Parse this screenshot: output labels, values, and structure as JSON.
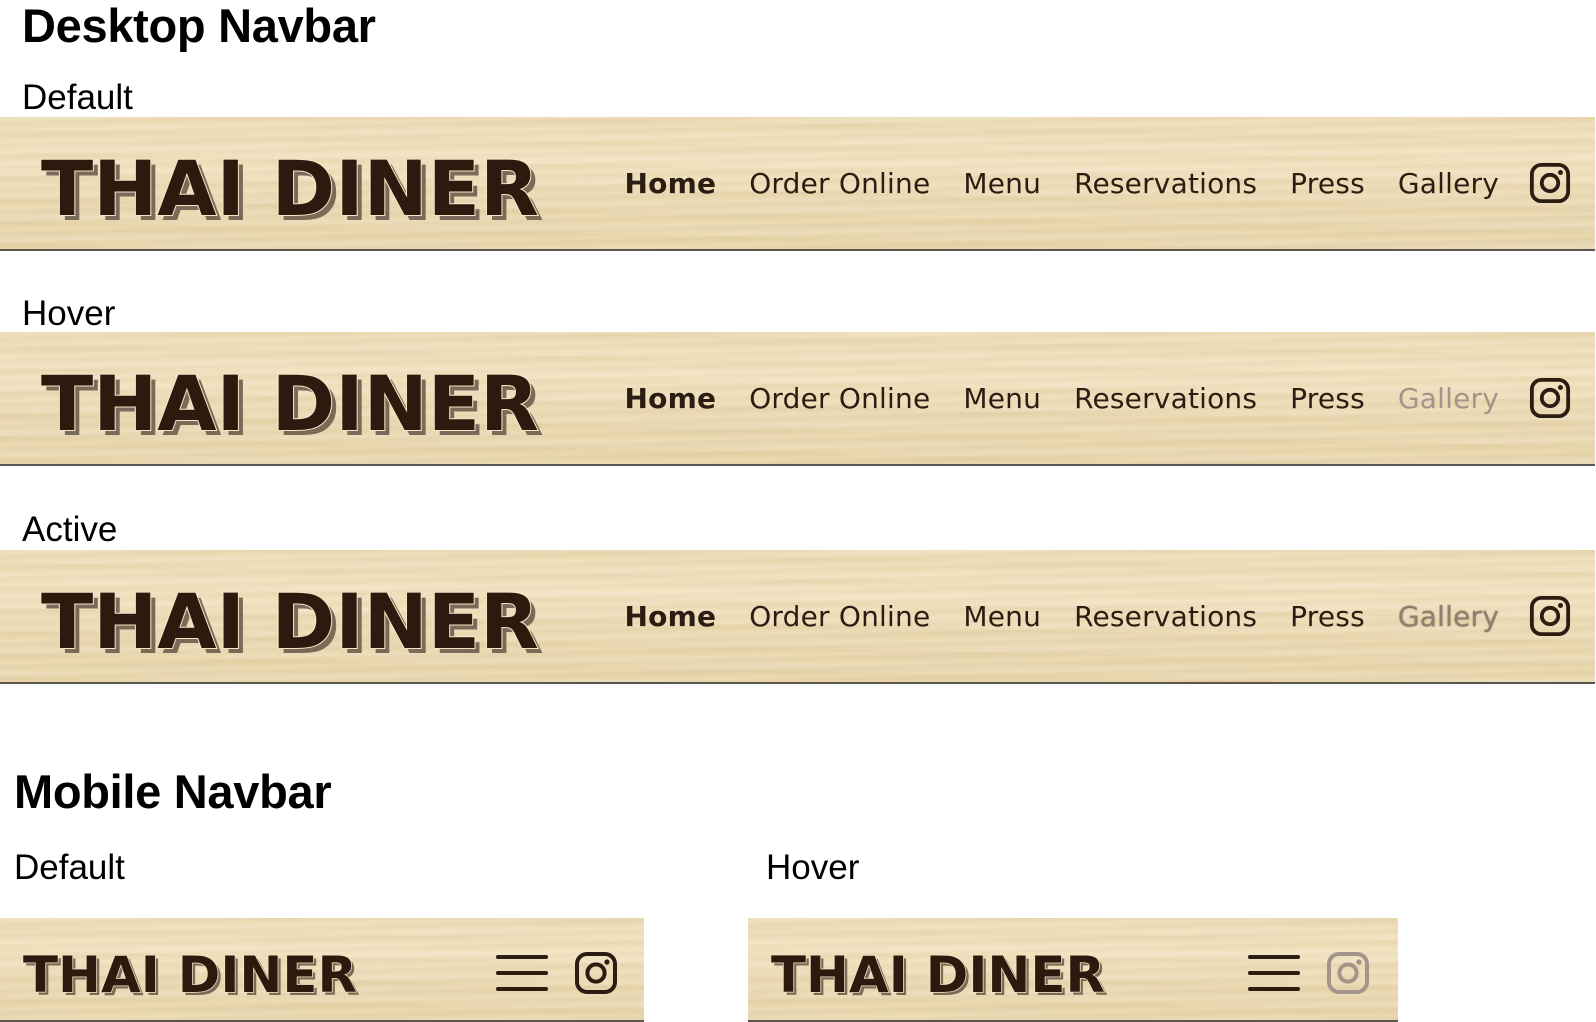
{
  "desktop": {
    "heading": "Desktop Navbar",
    "states": [
      {
        "label": "Default"
      },
      {
        "label": "Hover"
      },
      {
        "label": "Active"
      }
    ]
  },
  "brand": {
    "logo_text": "THAI DINER",
    "logo_color": "#2c1a0f",
    "logo_outline": "#f4e6c4",
    "logo_shadow": "#7a6a58"
  },
  "nav": {
    "links": [
      "Home",
      "Order Online",
      "Menu",
      "Reservations",
      "Press",
      "Gallery"
    ],
    "instagram_icon": "instagram-icon"
  },
  "mobile": {
    "heading": "Mobile Navbar",
    "states": [
      {
        "label": "Default"
      },
      {
        "label": "Hover"
      }
    ],
    "menu_icon": "hamburger-menu-icon"
  },
  "colors": {
    "wood": "#ecdcb5",
    "text": "#2c1d12",
    "hover": "#a3958a",
    "border": "#5b5750"
  }
}
